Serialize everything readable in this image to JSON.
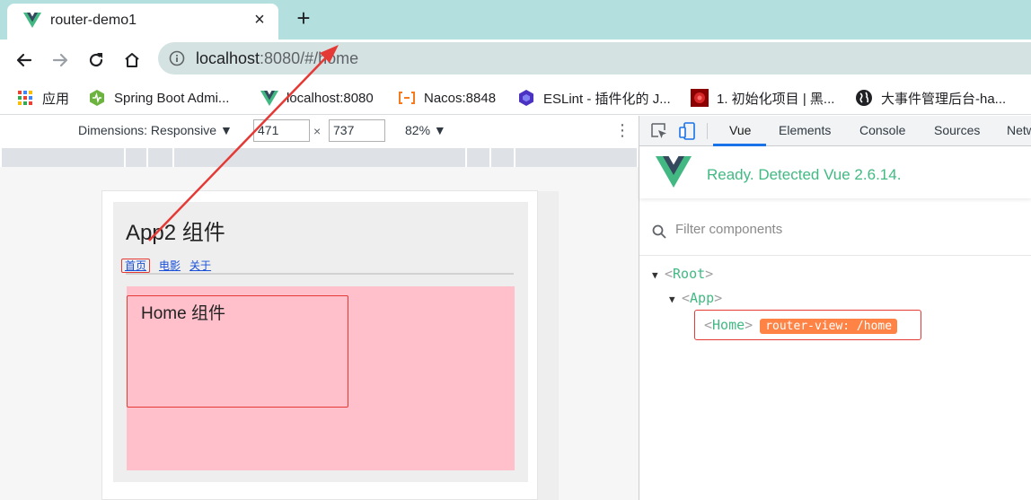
{
  "browser": {
    "tab_title": "router-demo1",
    "tab_icon": "vue-logo-icon",
    "close_icon": "×",
    "new_tab_icon": "+",
    "url_host": "localhost",
    "url_rest": ":8080/#/home"
  },
  "bookmarks": [
    {
      "label": "应用",
      "icon": "apps-grid-icon"
    },
    {
      "label": "Spring Boot Admi...",
      "icon": "spring-boot-icon"
    },
    {
      "label": "localhost:8080",
      "icon": "vue-logo-icon"
    },
    {
      "label": "Nacos:8848",
      "icon": "nacos-icon"
    },
    {
      "label": "ESLint - 插件化的 J...",
      "icon": "eslint-icon"
    },
    {
      "label": "1. 初始化项目 | 黑...",
      "icon": "red-avatar-icon"
    },
    {
      "label": "大事件管理后台-ha...",
      "icon": "globe-icon"
    }
  ],
  "emulation": {
    "dimensions_label": "Dimensions: Responsive ▼",
    "width": "471",
    "height": "737",
    "times": "×",
    "zoom_label": "82% ▼",
    "kebab": "⋮"
  },
  "app": {
    "title": "App2 组件",
    "nav": [
      "首页",
      "电影",
      "关于"
    ],
    "home_title": "Home 组件"
  },
  "devtools": {
    "tabs": [
      "Vue",
      "Elements",
      "Console",
      "Sources",
      "Netw"
    ],
    "ready_text": "Ready. Detected Vue 2.6.14.",
    "filter_placeholder": "Filter components",
    "tree": {
      "root": "Root",
      "app": "App",
      "home": "Home",
      "home_badge": "router-view: /home",
      "open_bracket": "<",
      "close_bracket": ">",
      "expand_marker": "▼"
    }
  },
  "colors": {
    "tabstrip": "#b3e0df",
    "vue_green": "#42b983",
    "annotation_red": "#e53935",
    "pink_area": "#ffc0cb",
    "badge_orange": "#ff8344"
  }
}
